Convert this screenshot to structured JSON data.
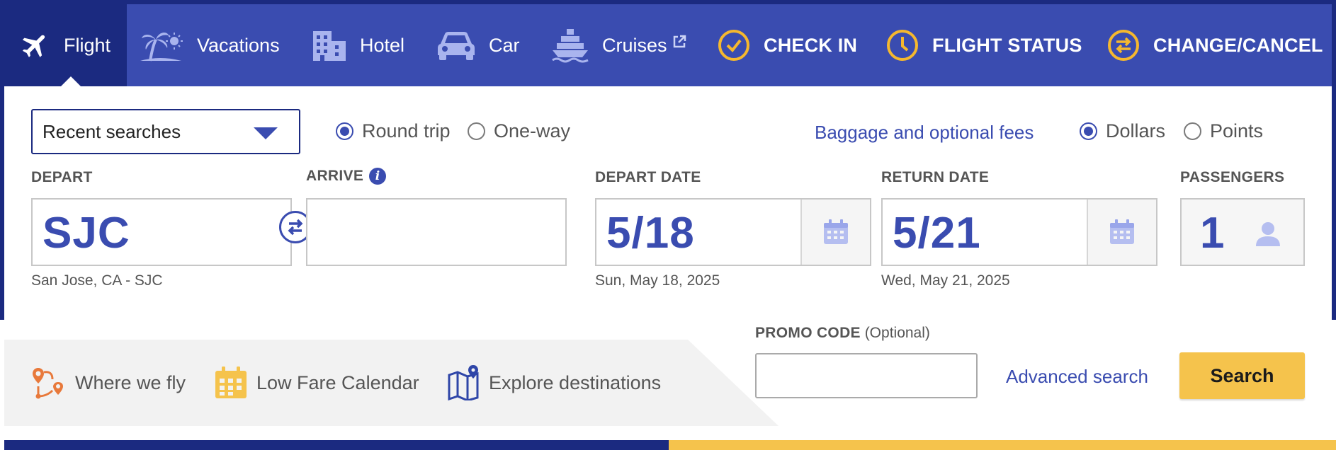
{
  "nav": {
    "items": [
      {
        "label": "Flight",
        "icon": "airplane-icon",
        "active": true
      },
      {
        "label": "Vacations",
        "icon": "palm-tree-sun-icon"
      },
      {
        "label": "Hotel",
        "icon": "hotel-building-icon"
      },
      {
        "label": "Car",
        "icon": "car-icon"
      },
      {
        "label": "Cruises",
        "icon": "cruise-ship-icon",
        "external_icon": "external-link-icon"
      },
      {
        "label": "CHECK IN",
        "icon": "checkmark-circle-icon"
      },
      {
        "label": "FLIGHT STATUS",
        "icon": "clock-icon"
      },
      {
        "label": "CHANGE/CANCEL",
        "icon": "swap-arrows-icon"
      }
    ],
    "colors": {
      "bar": "#3a4cb0",
      "active": "#1b2a80",
      "accent": "#f5b82e"
    }
  },
  "search": {
    "recent_searches": "Recent searches",
    "trip_type": {
      "options": [
        "Round trip",
        "One-way"
      ],
      "selected": "Round trip"
    },
    "baggage_link": "Baggage and optional fees",
    "currency": {
      "options": [
        "Dollars",
        "Points"
      ],
      "selected": "Dollars"
    },
    "depart": {
      "label": "DEPART",
      "value": "SJC",
      "sub": "San Jose, CA - SJC"
    },
    "arrive": {
      "label": "ARRIVE",
      "value": "",
      "info_icon": "info-icon"
    },
    "depart_date": {
      "label": "DEPART DATE",
      "value": "5/18",
      "sub": "Sun, May 18, 2025"
    },
    "return_date": {
      "label": "RETURN DATE",
      "value": "5/21",
      "sub": "Wed, May 21, 2025"
    },
    "passengers": {
      "label": "PASSENGERS",
      "value": "1"
    },
    "promo": {
      "label": "PROMO CODE",
      "optional": "(Optional)",
      "value": ""
    },
    "advanced_link": "Advanced search",
    "search_button": "Search"
  },
  "quick_links": [
    {
      "label": "Where we fly",
      "icon": "route-map-icon"
    },
    {
      "label": "Low Fare Calendar",
      "icon": "calendar-icon"
    },
    {
      "label": "Explore destinations",
      "icon": "map-pin-icon"
    }
  ],
  "colors": {
    "brand_blue": "#3a4cb0",
    "dark_blue": "#1b2a80",
    "yellow": "#f5c34c",
    "orange": "#e8793b"
  }
}
